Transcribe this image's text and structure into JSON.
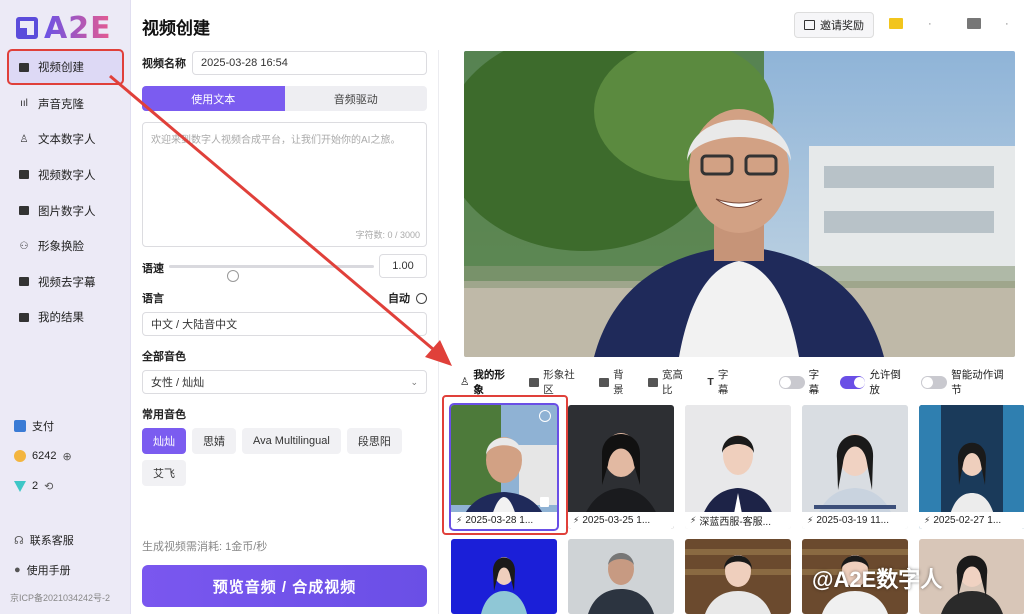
{
  "app": {
    "logo_text": "A2E",
    "page_title": "视频创建"
  },
  "sidebar": {
    "items": [
      {
        "label": "视频创建",
        "icon": "video-icon",
        "active": true
      },
      {
        "label": "声音克隆",
        "icon": "waveform-icon"
      },
      {
        "label": "文本数字人",
        "icon": "text-avatar-icon"
      },
      {
        "label": "视频数字人",
        "icon": "video-avatar-icon"
      },
      {
        "label": "图片数字人",
        "icon": "image-avatar-icon"
      },
      {
        "label": "形象换脸",
        "icon": "face-swap-icon"
      },
      {
        "label": "视频去字幕",
        "icon": "subtitle-remove-icon"
      },
      {
        "label": "我的结果",
        "icon": "results-icon"
      }
    ],
    "pay_label": "支付",
    "coins": "6242",
    "gems": "2",
    "support_label": "联系客服",
    "manual_label": "使用手册",
    "icp": "京ICP备2021034242号-2"
  },
  "header": {
    "invite_label": "邀请奖励"
  },
  "form": {
    "name_label": "视频名称",
    "name_value": "2025-03-28 16:54",
    "tabs": [
      {
        "label": "使用文本",
        "active": true
      },
      {
        "label": "音频驱动",
        "active": false
      }
    ],
    "text_placeholder": "欢迎来到数字人视频合成平台，让我们开始你的AI之旅。",
    "char_count": "字符数: 0 / 3000",
    "speed_label": "语速",
    "speed_value": "1.00",
    "speed_fraction": 0.3,
    "language_label": "语言",
    "auto_label": "自动",
    "language_value": "中文 / 大陆音中文",
    "all_voices_label": "全部音色",
    "voice_value": "女性 / 灿灿",
    "common_voices_label": "常用音色",
    "common_voices": [
      {
        "label": "灿灿",
        "active": true
      },
      {
        "label": "思婧",
        "active": false
      },
      {
        "label": "Ava Multilingual",
        "active": false
      },
      {
        "label": "段思阳",
        "active": false
      },
      {
        "label": "艾飞",
        "active": false
      }
    ],
    "cost_text": "生成视频需消耗: 1金币/秒",
    "submit_label": "预览音频 / 合成视频"
  },
  "toolbar": {
    "tabs": [
      {
        "label": "我的形象",
        "icon": "person-icon",
        "active": true
      },
      {
        "label": "形象社区",
        "icon": "community-icon",
        "active": false
      },
      {
        "label": "背景",
        "icon": "image-icon",
        "active": false
      },
      {
        "label": "宽高比",
        "icon": "aspect-ratio-icon",
        "active": false
      },
      {
        "label": "字幕",
        "icon": "text-icon",
        "active": false
      }
    ],
    "toggles": [
      {
        "label": "字幕",
        "on": false
      },
      {
        "label": "允许倒放",
        "on": true
      },
      {
        "label": "智能动作调节",
        "on": false
      }
    ]
  },
  "avatars": [
    {
      "caption": "2025-03-28 1...",
      "selected": true
    },
    {
      "caption": "2025-03-25 1...",
      "selected": false
    },
    {
      "caption": "深蓝西服-客服...",
      "selected": false
    },
    {
      "caption": "2025-03-19 11...",
      "selected": false
    },
    {
      "caption": "2025-02-27 1...",
      "selected": false
    }
  ],
  "watermark": "@A2E数字人",
  "colors": {
    "accent": "#6a4fe6",
    "highlight": "#e0403a"
  }
}
